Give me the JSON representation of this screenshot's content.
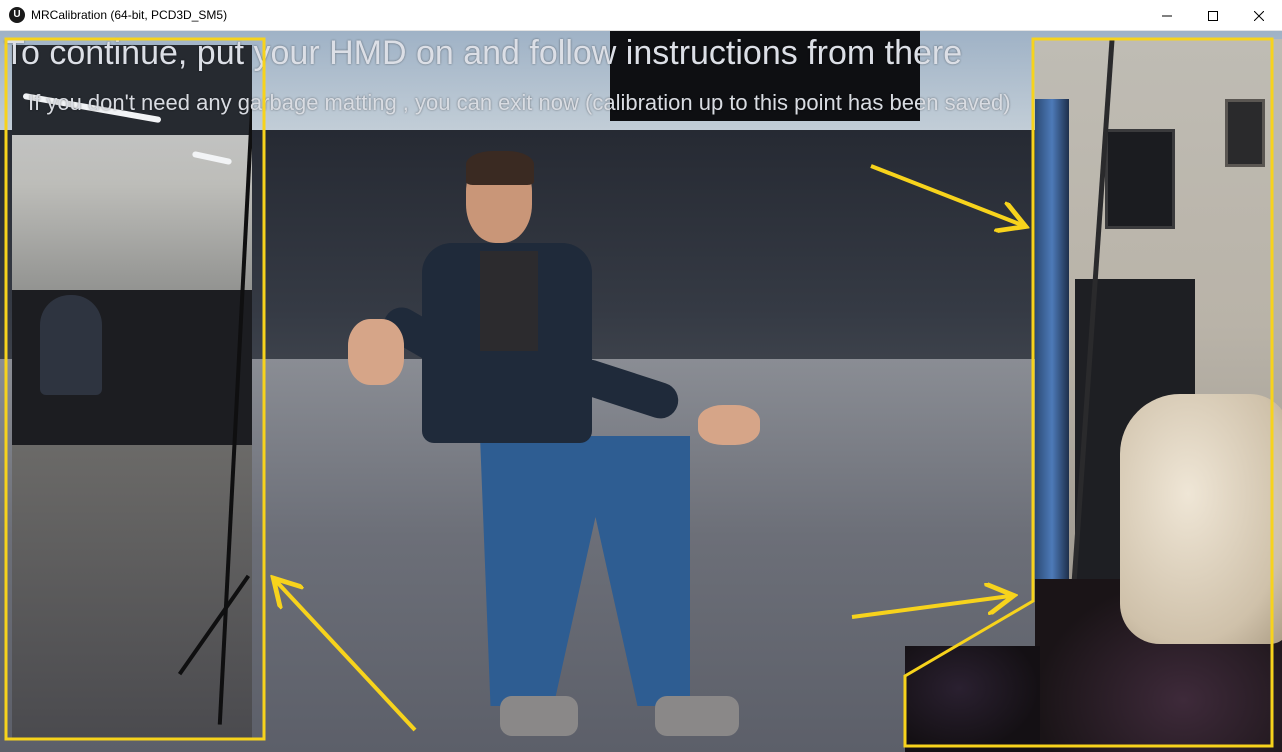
{
  "window": {
    "title": "MRCalibration (64-bit, PCD3D_SM5)",
    "app_icon": "unreal-engine-icon",
    "app_icon_glyph": "U",
    "controls": [
      "minimize-icon",
      "maximize-icon",
      "close-icon"
    ]
  },
  "overlay": {
    "title": "To continue, put your HMD on and follow instructions from there",
    "subtitle": "If you don't need any garbage matting , you can exit now (calibration up to this point has been saved)"
  },
  "annotation_color": "#f7d31c"
}
